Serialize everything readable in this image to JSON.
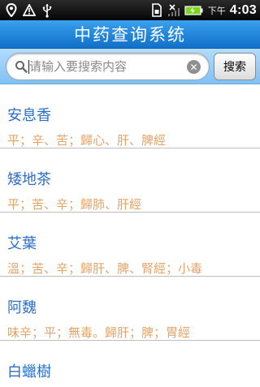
{
  "status_bar": {
    "ampm": "下午",
    "time": "4:03",
    "icons": [
      "location-pin-icon",
      "warning-icon",
      "usb-icon",
      "sim-card-icon",
      "no-signal-icon",
      "battery-charging-icon"
    ]
  },
  "header": {
    "title": "中药查询系统"
  },
  "search": {
    "placeholder": "请输入要搜索内容",
    "value": "",
    "clear_icon": "clear-icon",
    "button_label": "搜索"
  },
  "herbs": [
    {
      "name": "安息香",
      "properties": "平；辛、苦；歸心、肝、脾經"
    },
    {
      "name": "矮地茶",
      "properties": "平；苦、辛；歸肺、肝經"
    },
    {
      "name": "艾葉",
      "properties": "溫；苦、辛；歸肝、脾、腎經；小毒"
    },
    {
      "name": "阿魏",
      "properties": "味辛；平；無毒。歸肝；脾；胃經"
    },
    {
      "name": "白蠟樹",
      "properties": ""
    }
  ],
  "colors": {
    "title_bar": "#1f86db",
    "search_bar": "#9fd1fb",
    "herb_name": "#2d6fc9",
    "herb_properties": "#e2a469"
  }
}
